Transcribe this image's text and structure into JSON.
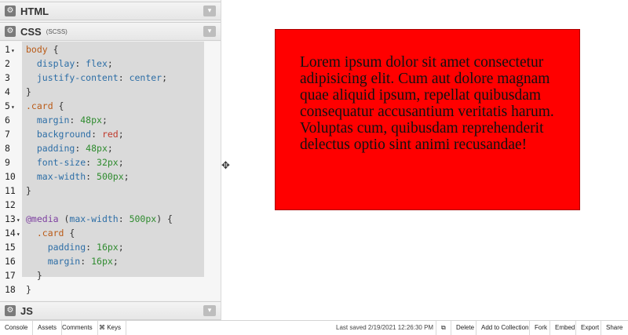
{
  "panels": {
    "html": {
      "title": "HTML",
      "gear": "⚙",
      "chevron": "▾"
    },
    "css": {
      "title": "CSS",
      "subtitle": "(SCSS)",
      "gear": "⚙",
      "chevron": "▾"
    },
    "js": {
      "title": "JS",
      "gear": "⚙",
      "chevron": "▾"
    }
  },
  "code": {
    "line_numbers": [
      "1",
      "2",
      "3",
      "4",
      "5",
      "6",
      "7",
      "8",
      "9",
      "10",
      "11",
      "12",
      "13",
      "14",
      "15",
      "16",
      "17",
      "18"
    ],
    "fold_marker": "▾",
    "lines": [
      [
        {
          "t": "body",
          "c": "sel"
        },
        {
          "t": " {",
          "c": "pun"
        }
      ],
      [
        {
          "t": "  display",
          "c": "prop"
        },
        {
          "t": ": ",
          "c": "pun"
        },
        {
          "t": "flex",
          "c": "prop"
        },
        {
          "t": ";",
          "c": "pun"
        }
      ],
      [
        {
          "t": "  justify-content",
          "c": "prop"
        },
        {
          "t": ": ",
          "c": "pun"
        },
        {
          "t": "center",
          "c": "prop"
        },
        {
          "t": ";",
          "c": "pun"
        }
      ],
      [
        {
          "t": "}",
          "c": "pun"
        }
      ],
      [
        {
          "t": ".card",
          "c": "sel"
        },
        {
          "t": " {",
          "c": "pun"
        }
      ],
      [
        {
          "t": "  margin",
          "c": "prop"
        },
        {
          "t": ": ",
          "c": "pun"
        },
        {
          "t": "48px",
          "c": "val"
        },
        {
          "t": ";",
          "c": "pun"
        }
      ],
      [
        {
          "t": "  background",
          "c": "prop"
        },
        {
          "t": ": ",
          "c": "pun"
        },
        {
          "t": "red",
          "c": "red"
        },
        {
          "t": ";",
          "c": "pun"
        }
      ],
      [
        {
          "t": "  padding",
          "c": "prop"
        },
        {
          "t": ": ",
          "c": "pun"
        },
        {
          "t": "48px",
          "c": "val"
        },
        {
          "t": ";",
          "c": "pun"
        }
      ],
      [
        {
          "t": "  font-size",
          "c": "prop"
        },
        {
          "t": ": ",
          "c": "pun"
        },
        {
          "t": "32px",
          "c": "val"
        },
        {
          "t": ";",
          "c": "pun"
        }
      ],
      [
        {
          "t": "  max-width",
          "c": "prop"
        },
        {
          "t": ": ",
          "c": "pun"
        },
        {
          "t": "500px",
          "c": "val"
        },
        {
          "t": ";",
          "c": "pun"
        }
      ],
      [
        {
          "t": "}",
          "c": "pun"
        }
      ],
      [],
      [
        {
          "t": "@media",
          "c": "at"
        },
        {
          "t": " (",
          "c": "pun"
        },
        {
          "t": "max-width",
          "c": "prop"
        },
        {
          "t": ": ",
          "c": "pun"
        },
        {
          "t": "500px",
          "c": "val"
        },
        {
          "t": ") {",
          "c": "pun"
        }
      ],
      [
        {
          "t": "  .card",
          "c": "sel"
        },
        {
          "t": " {",
          "c": "pun"
        }
      ],
      [
        {
          "t": "    padding",
          "c": "prop"
        },
        {
          "t": ": ",
          "c": "pun"
        },
        {
          "t": "16px",
          "c": "val"
        },
        {
          "t": ";",
          "c": "pun"
        }
      ],
      [
        {
          "t": "    margin",
          "c": "prop"
        },
        {
          "t": ": ",
          "c": "pun"
        },
        {
          "t": "16px",
          "c": "val"
        },
        {
          "t": ";",
          "c": "pun"
        }
      ],
      [
        {
          "t": "  }",
          "c": "pun"
        }
      ],
      [
        {
          "t": "}",
          "c": "pun"
        }
      ]
    ],
    "foldable_lines": [
      1,
      5,
      13,
      14
    ]
  },
  "preview": {
    "card_text": "Lorem ipsum dolor sit amet consectetur adipisicing elit. Cum aut dolore magnam quae aliquid ipsum, repellat quibusdam consequatur accusantium veritatis harum. Voluptas cum, quibusdam reprehenderit delectus optio sint animi recusandae!",
    "card_background": "#ff0000"
  },
  "resize_icon": "✥",
  "bottombar": {
    "left": [
      "Console",
      "Assets",
      "Comments",
      "⌘ Keys"
    ],
    "last_saved": "Last saved 2/19/2021 12:26:30 PM",
    "external_icon": "⧉",
    "right": [
      "Delete",
      "Add to Collection",
      "Fork",
      "Embed",
      "Export",
      "Share"
    ]
  }
}
